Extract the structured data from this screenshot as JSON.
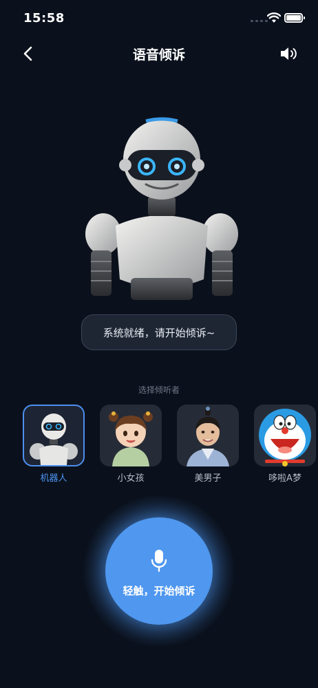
{
  "status_bar": {
    "time": "15:58"
  },
  "header": {
    "title": "语音倾诉",
    "back_icon": "chevron-left-icon",
    "speaker_icon": "speaker-icon"
  },
  "status_message": "系统就绪，请开始倾诉~",
  "listener_section": {
    "label": "选择倾听者",
    "selected_index": 0,
    "items": [
      {
        "label": "机器人",
        "avatar": "robot-avatar"
      },
      {
        "label": "小女孩",
        "avatar": "little-girl-avatar"
      },
      {
        "label": "美男子",
        "avatar": "handsome-man-avatar"
      },
      {
        "label": "哆啦A梦",
        "avatar": "doraemon-avatar"
      }
    ]
  },
  "mic": {
    "label": "轻触，开始倾诉",
    "icon": "microphone-icon"
  },
  "colors": {
    "background": "#0b111c",
    "accent": "#4f97ef",
    "selected_text": "#4d95f5"
  }
}
